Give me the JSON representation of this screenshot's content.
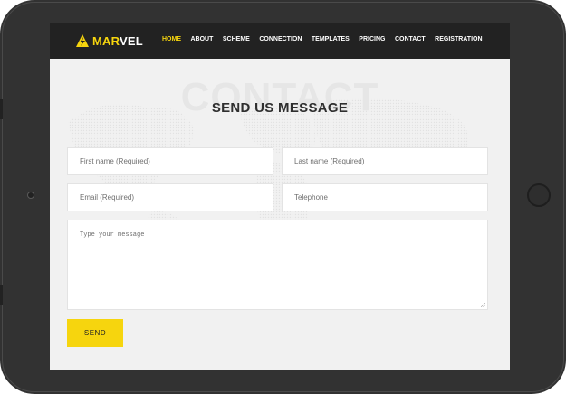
{
  "header": {
    "logo_text_accent": "MAR",
    "logo_text_rest": "VEL",
    "nav": [
      {
        "label": "HOME",
        "active": true
      },
      {
        "label": "ABOUT",
        "active": false
      },
      {
        "label": "SCHEME",
        "active": false
      },
      {
        "label": "CONNECTION",
        "active": false
      },
      {
        "label": "TEMPLATES",
        "active": false
      },
      {
        "label": "PRICING",
        "active": false
      },
      {
        "label": "CONTACT",
        "active": false
      },
      {
        "label": "REGISTRATION",
        "active": false
      }
    ]
  },
  "contact": {
    "watermark": "CONTACT",
    "heading": "SEND US MESSAGE",
    "first_name_placeholder": "First name (Required)",
    "last_name_placeholder": "Last name (Required)",
    "email_placeholder": "Email (Required)",
    "telephone_placeholder": "Telephone",
    "message_placeholder": "Type your message",
    "send_label": "SEND"
  },
  "colors": {
    "accent": "#f6d50e",
    "navbar": "#222222",
    "device": "#323232",
    "page_background": "#f1f1f1"
  },
  "icons": {
    "logo": "lightning-triangle-icon",
    "camera": "camera-dot",
    "home_button": "home-button-circle"
  }
}
